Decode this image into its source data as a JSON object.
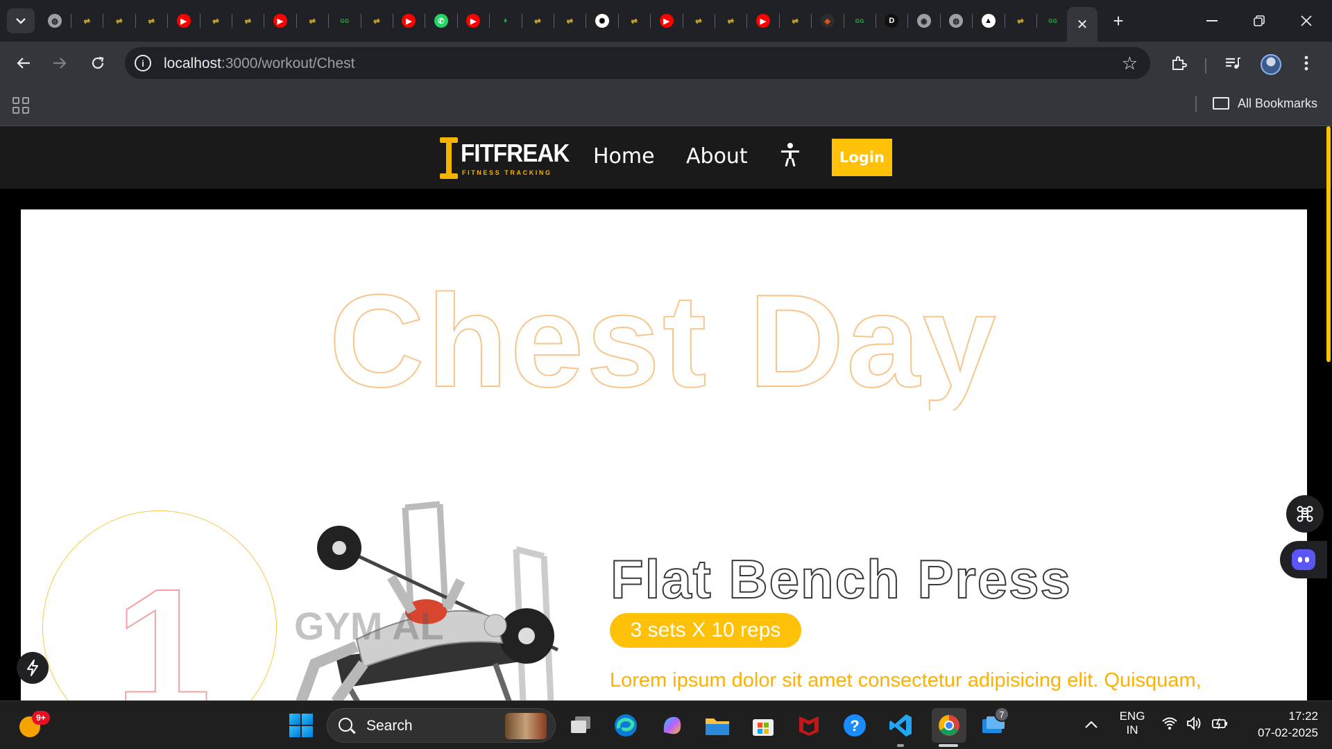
{
  "browser": {
    "tab_icons": [
      "globe",
      "fitfreak",
      "fitfreak",
      "fitfreak",
      "youtube",
      "fitfreak",
      "fitfreak",
      "youtube",
      "fitfreak",
      "gfg",
      "fitfreak",
      "youtube",
      "whatsapp",
      "youtube",
      "mongodb",
      "fitfreak",
      "fitfreak",
      "chatgpt",
      "fitfreak",
      "youtube",
      "fitfreak",
      "fitfreak",
      "youtube",
      "fitfreak",
      "figma",
      "gfg",
      "dev",
      "chrome",
      "globe",
      "vercel",
      "fitfreak",
      "gfg"
    ],
    "active_tab_close": "✕",
    "new_tab": "+",
    "url_host": "localhost",
    "url_path": ":3000/workout/Chest",
    "bookmarks_label": "All Bookmarks",
    "colors": {
      "tab_strip": "#202124",
      "toolbar": "#35363a"
    }
  },
  "site": {
    "logo_text": "FITFREAK",
    "logo_sub": "FITNESS TRACKING",
    "nav": {
      "home": "Home",
      "about": "About",
      "login": "Login"
    },
    "colors": {
      "accent": "#ffc107",
      "title_outline": "#f9c48a",
      "number_outline": "#f4a0a0"
    }
  },
  "workout": {
    "title": "Chest Day",
    "exercise": {
      "number": "1",
      "name": "Flat Bench Press",
      "sets_reps": "3 sets X 10 reps",
      "description": "Lorem ipsum dolor sit amet consectetur adipisicing elit. Quisquam,",
      "image_watermark": "GYM  AL"
    }
  },
  "taskbar": {
    "weather_badge": "9+",
    "search_label": "Search",
    "lang_line1": "ENG",
    "lang_line2": "IN",
    "time": "17:22",
    "date": "07-02-2025",
    "vscode_badge": "7"
  }
}
